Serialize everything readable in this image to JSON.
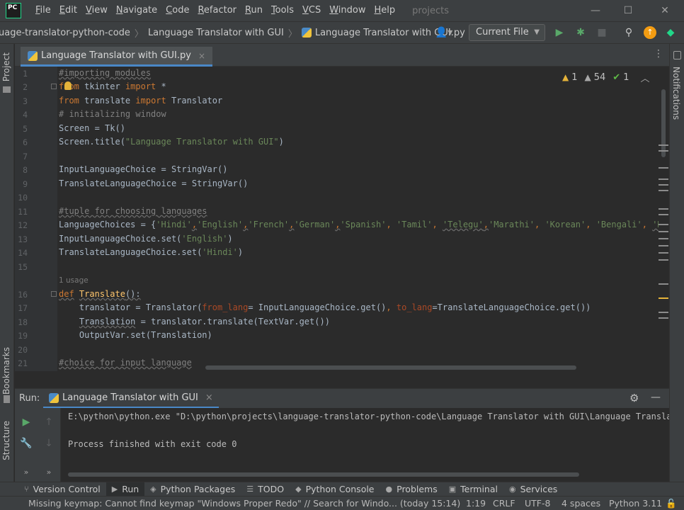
{
  "titlebar": {
    "logo_text": "PC",
    "menu": [
      {
        "label": "File",
        "mn": "F",
        "rest": "ile"
      },
      {
        "label": "Edit",
        "mn": "E",
        "rest": "dit"
      },
      {
        "label": "View",
        "mn": "V",
        "rest": "iew"
      },
      {
        "label": "Navigate",
        "mn": "N",
        "rest": "avigate"
      },
      {
        "label": "Code",
        "mn": "C",
        "rest": "ode"
      },
      {
        "label": "Refactor",
        "mn": "R",
        "rest": "efactor"
      },
      {
        "label": "Run",
        "mn": "R",
        "rest": "un"
      },
      {
        "label": "Tools",
        "mn": "T",
        "rest": "ools"
      },
      {
        "label": "VCS",
        "mn": "V",
        "rest": "CS"
      },
      {
        "label": "Window",
        "mn": "W",
        "rest": "indow"
      },
      {
        "label": "Help",
        "mn": "H",
        "rest": "elp"
      }
    ],
    "project": "projects"
  },
  "navbar": {
    "crumb_project": "uage-translator-python-code",
    "crumb_folder": "Language Translator with GUI",
    "crumb_file": "Language Translator with GUI.py",
    "run_config": "Current File"
  },
  "left_strip": {
    "project": "Project",
    "bookmarks": "Bookmarks",
    "structure": "Structure"
  },
  "right_strip": {
    "notifications": "Notifications"
  },
  "editor_tab": {
    "label": "Language Translator with GUI.py",
    "close": "×"
  },
  "inspection": {
    "warnings": "1",
    "weak_warnings": "54",
    "ok": "1"
  },
  "code": {
    "line_numbers": [
      "1",
      "2",
      "3",
      "4",
      "5",
      "6",
      "7",
      "8",
      "9",
      "10",
      "11",
      "12",
      "13",
      "14",
      "15",
      "16",
      "17",
      "18",
      "19",
      "20",
      "21"
    ],
    "usage_hint": "1 usage",
    "l1": "#importing modules",
    "l2_kw1": "from",
    "l2_mod": " tkinter ",
    "l2_kw2": "import",
    "l2_rest": " *",
    "l3_kw1": "from",
    "l3_mod": " translate ",
    "l3_kw2": "import",
    "l3_rest": " Translator",
    "l4": "# initializing window",
    "l5": "Screen = Tk()",
    "l6_a": "Screen.title(",
    "l6_str": "\"Language Translator with GUI\"",
    "l6_b": ")",
    "l8": "InputLanguageChoice = StringVar()",
    "l9": "TranslateLanguageChoice = StringVar()",
    "l11": "#tuple for choosing languages",
    "l12_a": "LanguageChoices = {",
    "l12_s1": "'Hindi'",
    "l12_s2": "'English'",
    "l12_s3": "'French'",
    "l12_s4": "'German'",
    "l12_s5": "'Spanish'",
    "l12_s6": "'Tamil'",
    "l12_s7": "'Telegu'",
    "l12_s8": "'Marathi'",
    "l12_s9": "'Korean'",
    "l12_s10": "'Bengali'",
    "l12_s11": "'Russ",
    "l13_a": "InputLanguageChoice.set(",
    "l13_str": "'English'",
    "l13_b": ")",
    "l14_a": "TranslateLanguageChoice.set(",
    "l14_str": "'Hindi'",
    "l14_b": ")",
    "l16_kw": "def",
    "l16_fn": "Translate",
    "l16_rest": "():",
    "l17_a": "    translator = Translator(",
    "l17_p1": "from_lang",
    "l17_b": "= InputLanguageChoice.get()",
    "l17_c": ",",
    "l17_p2": " to_lang",
    "l17_d": "=TranslateLanguageChoice.get())",
    "l18_pre": "    ",
    "l18_var": "Translation",
    "l18_rest": " = translator.translate(TextVar.get())",
    "l19": "    OutputVar.set(Translation)",
    "l21": "#choice for input language"
  },
  "run_panel": {
    "label": "Run:",
    "tab": "Language Translator with GUI",
    "tab_close": "×",
    "console_cmd": "E:\\python\\python.exe \"D:\\python\\projects\\language-translator-python-code\\Language Translator with GUI\\Language Translator with GUI.py\"",
    "console_exit": "Process finished with exit code 0"
  },
  "bottom_tools": [
    {
      "label": "Version Control",
      "icon": "⑂"
    },
    {
      "label": "Run",
      "icon": "▶"
    },
    {
      "label": "Python Packages",
      "icon": "◈"
    },
    {
      "label": "TODO",
      "icon": "☰"
    },
    {
      "label": "Python Console",
      "icon": "◆"
    },
    {
      "label": "Problems",
      "icon": "●"
    },
    {
      "label": "Terminal",
      "icon": "▣"
    },
    {
      "label": "Services",
      "icon": "◉"
    }
  ],
  "statusbar": {
    "message": "Missing keymap: Cannot find keymap \"Windows Proper Redo\" // Search for Windo... (today 15:14)",
    "position": "1:19",
    "line_sep": "CRLF",
    "encoding": "UTF-8",
    "indent": "4 spaces",
    "interpreter": "Python 3.11"
  },
  "colors": {
    "accent": "#4a88c7",
    "run_green": "#59a869",
    "warning": "#e5b33a",
    "update_orange": "#f39c12"
  }
}
